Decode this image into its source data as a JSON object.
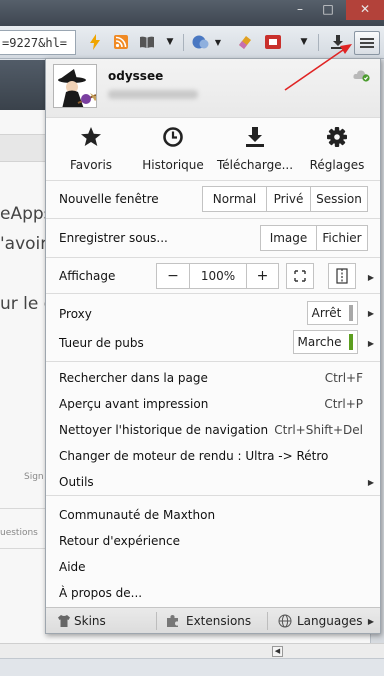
{
  "browser": {
    "address_text": "=9227&hl=",
    "page_fragments": [
      "eApps",
      "'avoir",
      "ur le cl"
    ],
    "page_small_texts": [
      "Sign",
      "uestions"
    ]
  },
  "profile": {
    "username": "odyssee"
  },
  "quick_actions": [
    {
      "label": "Favoris",
      "icon": "star-icon"
    },
    {
      "label": "Historique",
      "icon": "clock-icon"
    },
    {
      "label": "Télécharge...",
      "icon": "download-icon"
    },
    {
      "label": "Réglages",
      "icon": "gear-icon"
    }
  ],
  "new_window": {
    "label": "Nouvelle fenêtre",
    "options": [
      "Normal",
      "Privé",
      "Session"
    ]
  },
  "save_as": {
    "label": "Enregistrer sous...",
    "options": [
      "Image",
      "Fichier"
    ]
  },
  "display": {
    "label": "Affichage",
    "zoom_minus": "−",
    "zoom_value": "100%",
    "zoom_plus": "+"
  },
  "proxy": {
    "label": "Proxy",
    "state": "Arrêt",
    "indicator_color": "#a8a8a8"
  },
  "adblock": {
    "label": "Tueur de pubs",
    "state": "Marche",
    "indicator_color": "#5c9e1f"
  },
  "page_tools": [
    {
      "label": "Rechercher dans la page",
      "shortcut": "Ctrl+F"
    },
    {
      "label": "Aperçu avant impression",
      "shortcut": "Ctrl+P"
    },
    {
      "label": "Nettoyer l'historique de navigation",
      "shortcut": "Ctrl+Shift+Del"
    },
    {
      "label": "Changer de moteur de rendu : Ultra -> Rétro",
      "shortcut": ""
    },
    {
      "label": "Outils",
      "shortcut": ""
    }
  ],
  "info_items": [
    "Communauté de Maxthon",
    "Retour d'expérience",
    "Aide",
    "À propos de..."
  ],
  "footer": {
    "skins": "Skins",
    "extensions": "Extensions",
    "languages": "Languages"
  },
  "colors": {
    "annotation_arrow": "#e02424",
    "proxy_off": "#a8a8a8",
    "adblock_on": "#5c9e1f"
  }
}
